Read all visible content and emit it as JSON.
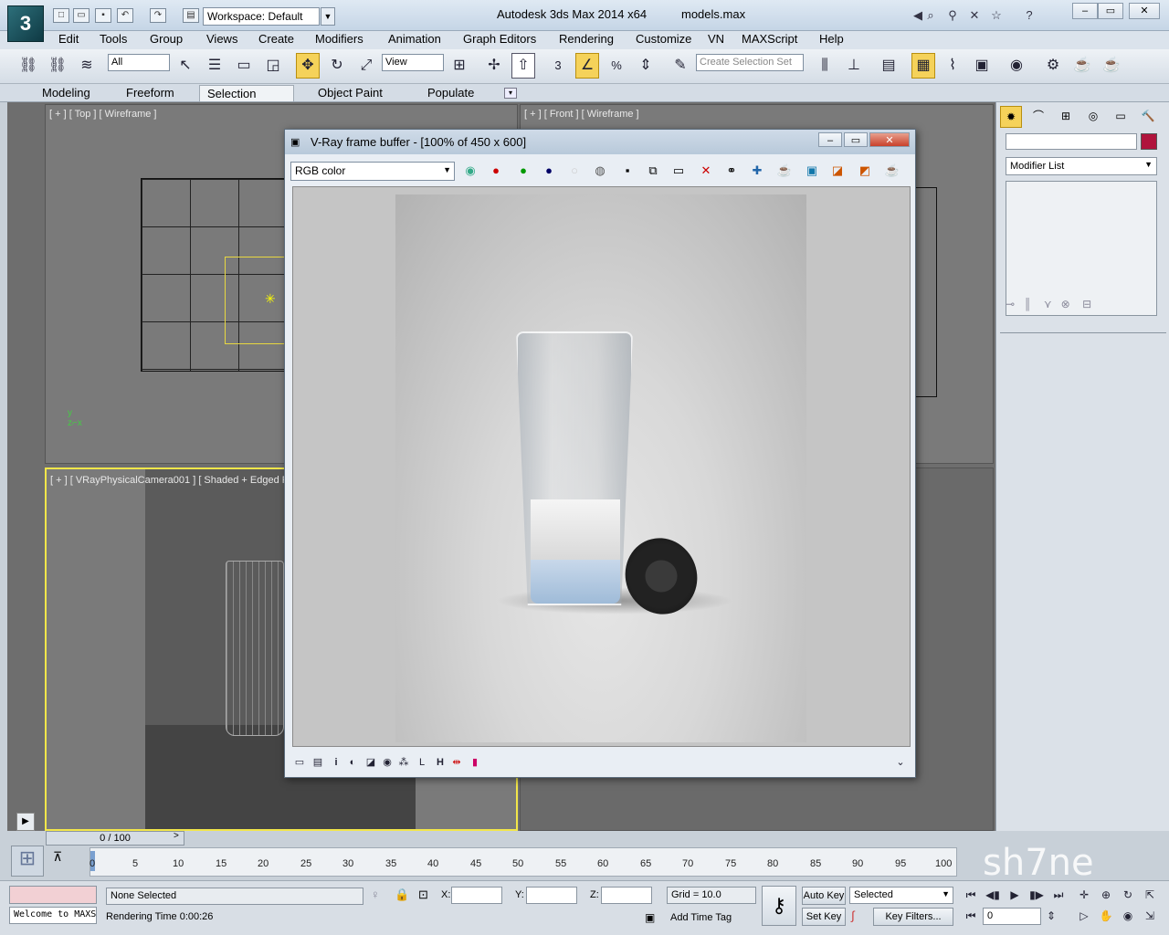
{
  "app": {
    "title": "Autodesk 3ds Max  2014 x64",
    "file": "models.max",
    "workspace": "Workspace: Default"
  },
  "menu": [
    "Edit",
    "Tools",
    "Group",
    "Views",
    "Create",
    "Modifiers",
    "Animation",
    "Graph Editors",
    "Rendering",
    "Customize",
    "VN",
    "MAXScript",
    "Help"
  ],
  "toolbar": {
    "selection_filter": "All",
    "ref_coord": "View",
    "selection_set_placeholder": "Create Selection Set",
    "snap_value": "3"
  },
  "ribbon": {
    "tabs": [
      "Modeling",
      "Freeform",
      "Selection",
      "Object Paint",
      "Populate"
    ],
    "active": "Selection"
  },
  "viewports": {
    "top": "[ + ] [ Top ] [ Wireframe ]",
    "front": "[ + ] [ Front ] [ Wireframe ]",
    "persp": "[ + ] [ VRayPhysicalCamera001 ] [ Shaded + Edged Faces ]"
  },
  "vfb": {
    "title": "V-Ray frame buffer - [100% of 450 x 600]",
    "channel": "RGB color"
  },
  "command_panel": {
    "modifier_list": "Modifier List",
    "object_color": "#b0143c"
  },
  "timeline": {
    "frame": "0 / 100",
    "ticks": [
      "0",
      "5",
      "10",
      "15",
      "20",
      "25",
      "30",
      "35",
      "40",
      "45",
      "50",
      "55",
      "60",
      "65",
      "70",
      "75",
      "80",
      "85",
      "90",
      "95",
      "100"
    ]
  },
  "status": {
    "maxscript": "Welcome to MAXS",
    "selection": "None Selected",
    "rendering_time": "Rendering Time  0:00:26",
    "x_label": "X:",
    "y_label": "Y:",
    "z_label": "Z:",
    "grid": "Grid = 10.0",
    "add_time_tag": "Add Time Tag",
    "auto_key": "Auto Key",
    "set_key": "Set Key",
    "key_mode": "Selected",
    "key_filters": "Key Filters...",
    "current_frame": "0"
  },
  "watermark": "sh7ne",
  "colors": {
    "accent": "#f5d25a",
    "selection_yellow": "#f2e64a"
  }
}
